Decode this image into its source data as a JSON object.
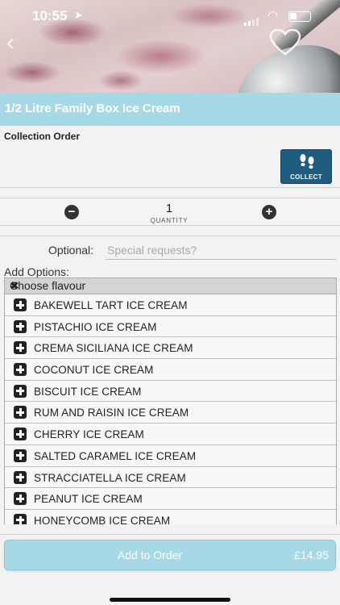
{
  "status_bar": {
    "time": "10:55"
  },
  "product": {
    "title": "1/2 Litre Family Box Ice Cream"
  },
  "order": {
    "type_label": "Collection Order",
    "collect_label": "COLLECT"
  },
  "quantity": {
    "value": "1",
    "label": "QUANTITY"
  },
  "requests": {
    "label": "Optional:",
    "placeholder": "Special requests?"
  },
  "options": {
    "heading": "Add Options:",
    "group_title": "Choose flavour",
    "items": [
      "BAKEWELL TART ICE CREAM",
      "PISTACHIO ICE CREAM",
      "CREMA SICILIANA ICE CREAM",
      "COCONUT ICE CREAM",
      "BISCUIT ICE CREAM",
      "RUM AND RAISIN ICE CREAM",
      "CHERRY ICE CREAM",
      "SALTED CARAMEL ICE CREAM",
      "STRACCIATELLA ICE CREAM",
      "PEANUT ICE CREAM",
      "HONEYCOMB ICE CREAM"
    ]
  },
  "cart": {
    "button_label": "Add to Order",
    "price": "£14.95"
  },
  "colors": {
    "accent": "#a6d8e5",
    "collect_button": "#1f5c80"
  }
}
